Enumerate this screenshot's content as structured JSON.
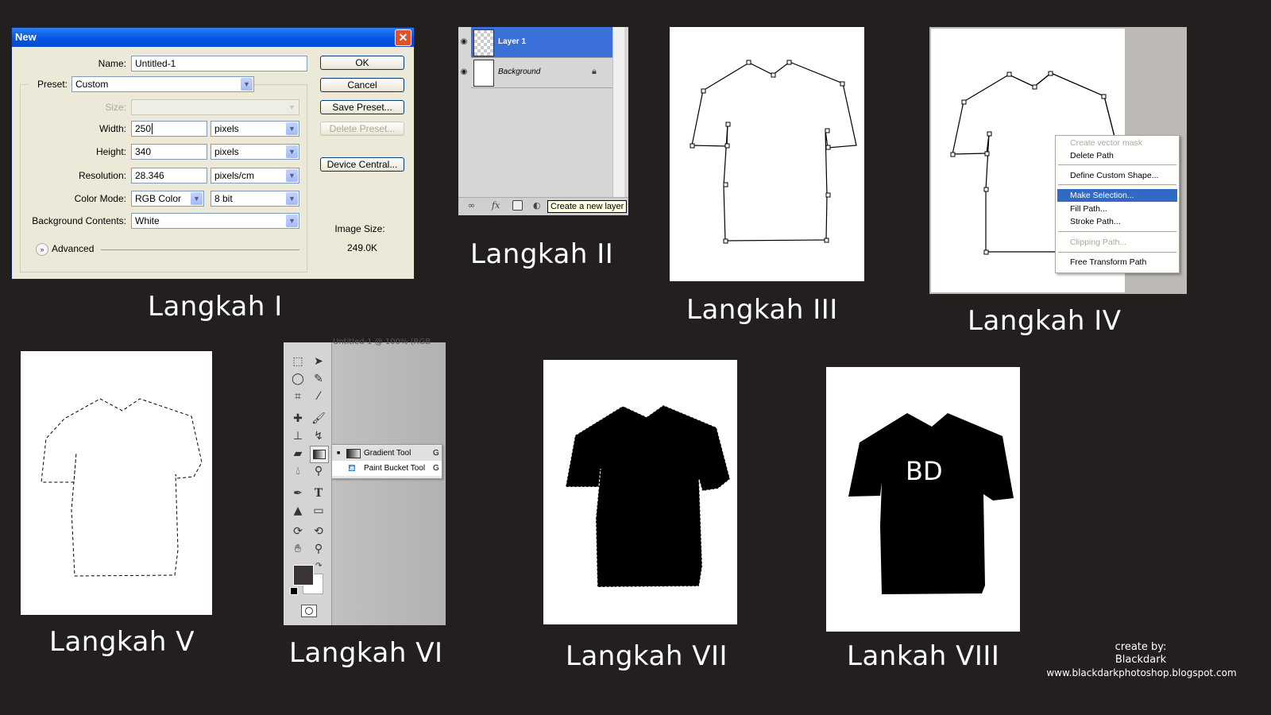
{
  "steps": {
    "s1": "Langkah I",
    "s2": "Langkah II",
    "s3": "Langkah III",
    "s4": "Langkah IV",
    "s5": "Langkah V",
    "s6": "Langkah VI",
    "s7": "Langkah VII",
    "s8": "Lankah VIII"
  },
  "new_dialog": {
    "title": "New",
    "close_icon": "close-icon",
    "name_label": "Name:",
    "name_value": "Untitled-1",
    "preset_label": "Preset:",
    "preset_value": "Custom",
    "size_label": "Size:",
    "size_value": "",
    "width_label": "Width:",
    "width_value": "250",
    "width_unit": "pixels",
    "height_label": "Height:",
    "height_value": "340",
    "height_unit": "pixels",
    "resolution_label": "Resolution:",
    "resolution_value": "28.346",
    "resolution_unit": "pixels/cm",
    "color_mode_label": "Color Mode:",
    "color_mode_value": "RGB Color",
    "bit_depth_value": "8 bit",
    "bg_contents_label": "Background Contents:",
    "bg_contents_value": "White",
    "advanced_label": "Advanced",
    "buttons": {
      "ok": "OK",
      "cancel": "Cancel",
      "save_preset": "Save Preset...",
      "delete_preset": "Delete Preset...",
      "device_central": "Device Central..."
    },
    "image_size_label": "Image Size:",
    "image_size_value": "249.0K"
  },
  "layers_panel": {
    "layers": [
      {
        "name": "Layer 1",
        "active": true
      },
      {
        "name": "Background",
        "locked": true
      }
    ],
    "tooltip": "Create a new layer"
  },
  "context_menu": {
    "items": [
      {
        "label": "Create vector mask",
        "disabled": true
      },
      {
        "label": "Delete Path"
      },
      {
        "label": "Define Custom Shape..."
      },
      {
        "label": "Make Selection...",
        "highlighted": true
      },
      {
        "label": "Fill Path..."
      },
      {
        "label": "Stroke Path..."
      },
      {
        "label": "Clipping Path...",
        "disabled": true
      },
      {
        "label": "Free Transform Path"
      }
    ]
  },
  "toolbox": {
    "doc_title": "Untitled-1 @ 100% (RGB",
    "flyout": [
      {
        "label": "Gradient Tool",
        "shortcut": "G",
        "selected": true
      },
      {
        "label": "Paint Bucket Tool",
        "shortcut": "G"
      }
    ]
  },
  "tshirt_text": "BD",
  "credit": {
    "line1": "create by:",
    "line2": "Blackdark",
    "line3": "www.blackdarkphotoshop.blogspot.com"
  }
}
